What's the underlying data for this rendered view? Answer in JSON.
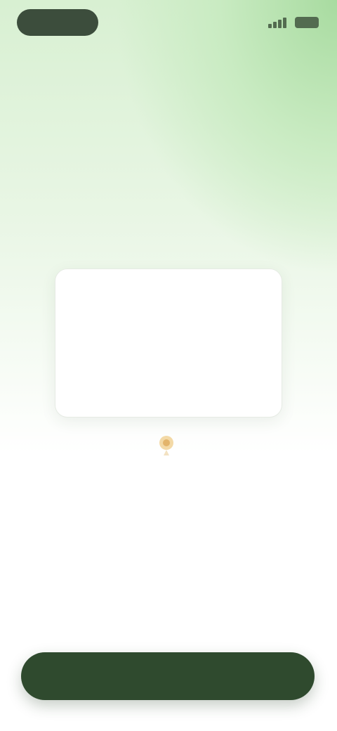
{
  "status_bar": {
    "time": "",
    "signal_icon": "signal-bars-icon",
    "battery_icon": "battery-icon"
  },
  "header": {
    "title": ""
  },
  "hero": {
    "headline": "",
    "description": ""
  },
  "card": {
    "title": "",
    "body": "",
    "link_label": ""
  },
  "marker": {
    "icon": "location-pin-icon"
  },
  "cta": {
    "label": ""
  },
  "colors": {
    "accent": "#2f4a2e",
    "gradient_light": "#c9ebc2",
    "marker": "#e3b46b"
  }
}
